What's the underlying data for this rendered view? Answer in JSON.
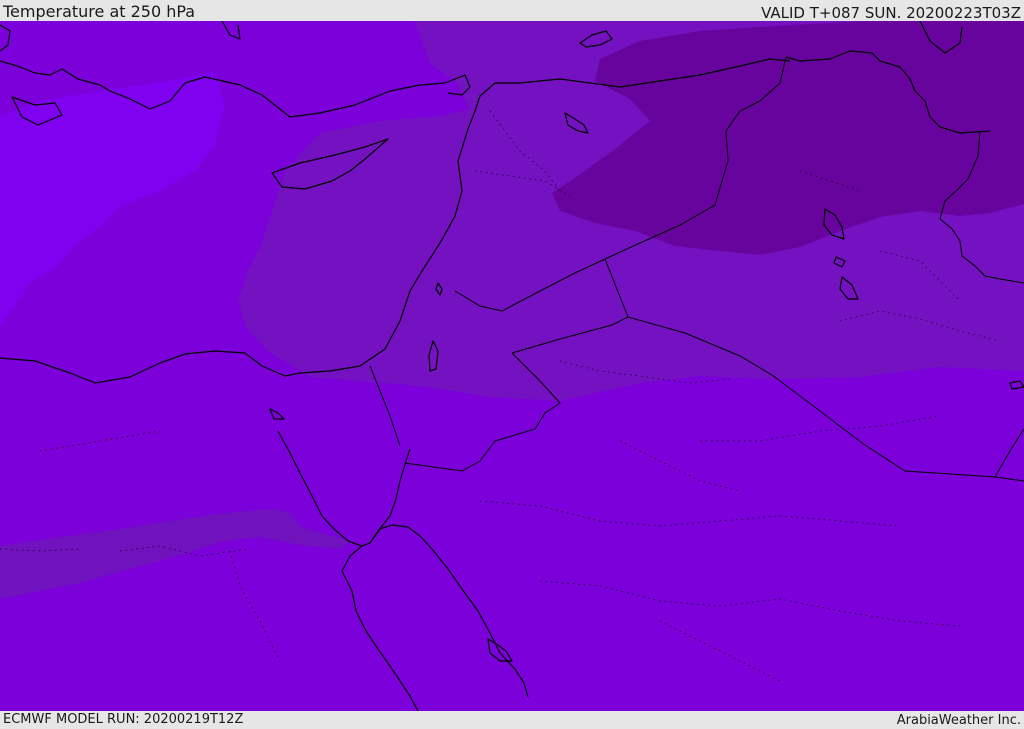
{
  "header": {
    "title": "Temperature at 250 hPa",
    "valid_time": "VALID T+087 SUN. 20200223T03Z"
  },
  "footer": {
    "model_run": "ECMWF MODEL RUN: 20200219T12Z",
    "credit": "ArabiaWeather Inc."
  },
  "colors": {
    "field_base": "#7b00d9",
    "field_light": "#8000f0",
    "field_mid": "#7411c0",
    "field_dark": "#68049e",
    "band_cool": "#7012bd",
    "coastline": "#000000",
    "bar_background": "#e6e6e6"
  }
}
